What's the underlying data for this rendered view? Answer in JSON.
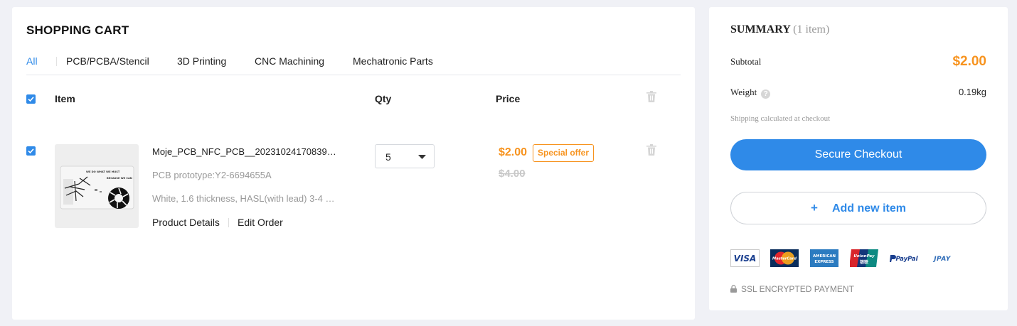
{
  "cart": {
    "title": "SHOPPING CART",
    "tabs": [
      {
        "label": "All",
        "active": true
      },
      {
        "label": "PCB/PCBA/Stencil"
      },
      {
        "label": "3D Printing"
      },
      {
        "label": "CNC Machining"
      },
      {
        "label": "Mechatronic Parts"
      }
    ],
    "columns": {
      "item": "Item",
      "qty": "Qty",
      "price": "Price"
    },
    "items": [
      {
        "checked": true,
        "name": "Moje_PCB_NFC_PCB__20231024170839…",
        "subtitle": "PCB prototype:Y2-6694655A",
        "spec": "White, 1.6 thickness, HASL(with lead) 3-4 …",
        "links": {
          "details": "Product Details",
          "edit": "Edit Order"
        },
        "qty": "5",
        "price": "$2.00",
        "badge": "Special offer",
        "old_price": "$4.00",
        "thumb_text": {
          "top": "WE DO WHAT WE MUST",
          "side": "BECAUSE WE CAN"
        }
      }
    ]
  },
  "summary": {
    "title": "SUMMARY",
    "count": "(1 item)",
    "subtotal_label": "Subtotal",
    "subtotal_value": "$2.00",
    "weight_label": "Weight",
    "help_symbol": "?",
    "weight_value": "0.19kg",
    "shipping_note": "Shipping calculated at checkout",
    "checkout_label": "Secure Checkout",
    "add_symbol": "+",
    "add_label": "Add new item",
    "payment_methods": {
      "visa": "VISA",
      "mastercard": "MasterCard",
      "amex_1": "AMERICAN",
      "amex_2": "EXPRESS",
      "unionpay_1": "UnionPay",
      "unionpay_2": "银联",
      "paypal": "PayPal",
      "jpay": "JPAY"
    },
    "ssl_label": "SSL ENCRYPTED PAYMENT"
  },
  "colors": {
    "accent": "#2f8ae8",
    "price": "#f7931e",
    "background": "#f0f1f6"
  }
}
